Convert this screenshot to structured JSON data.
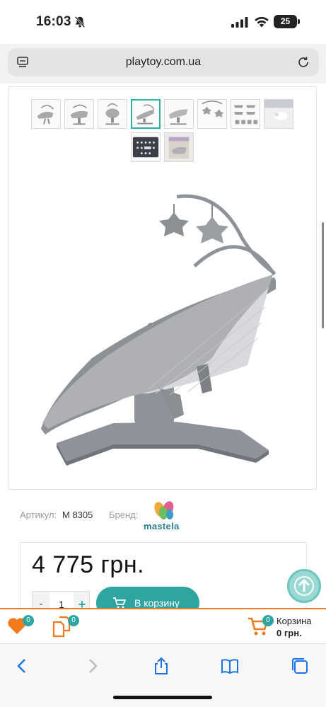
{
  "status_bar": {
    "time": "16:03",
    "battery": "25"
  },
  "browser": {
    "url": "playtoy.com.ua"
  },
  "product": {
    "article_label": "Артикул:",
    "article_value": "M 8305",
    "brand_label": "Бренд:",
    "brand_name": "mastela",
    "price": "4 775 грн.",
    "quantity": "1",
    "qty_minus": "-",
    "qty_plus": "+",
    "add_to_cart": "В корзину"
  },
  "sticky_bar": {
    "wishlist_count": "0",
    "compare_count": "0",
    "cart_count": "0",
    "cart_label": "Корзина",
    "cart_total": "0 грн."
  },
  "gallery": {
    "thumbnail_count": 10,
    "active_index": 3
  },
  "colors": {
    "accent": "#2ea5a0",
    "orange": "#f07a1c"
  }
}
